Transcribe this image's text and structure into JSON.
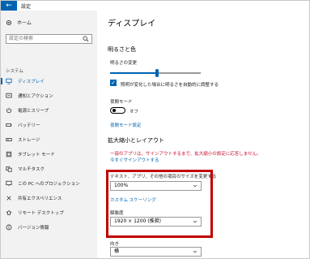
{
  "titlebar": {
    "back_glyph": "←",
    "title": "設定"
  },
  "sidebar": {
    "home_label": "ホーム",
    "search_placeholder": "設定の検索",
    "section_label": "システム",
    "items": [
      {
        "label": "ディスプレイ",
        "icon": "monitor-icon",
        "active": true
      },
      {
        "label": "通知とアクション",
        "icon": "notification-icon"
      },
      {
        "label": "電源とスリープ",
        "icon": "power-icon"
      },
      {
        "label": "バッテリー",
        "icon": "battery-icon"
      },
      {
        "label": "ストレージ",
        "icon": "storage-icon"
      },
      {
        "label": "タブレット モード",
        "icon": "tablet-icon"
      },
      {
        "label": "マルチタスク",
        "icon": "multitask-icon"
      },
      {
        "label": "この PC へのプロジェクション",
        "icon": "projection-icon"
      },
      {
        "label": "共有エクスペリエンス",
        "icon": "share-icon"
      },
      {
        "label": "リモート デスクトップ",
        "icon": "remote-icon"
      },
      {
        "label": "バージョン情報",
        "icon": "info-icon"
      }
    ]
  },
  "main": {
    "title": "ディスプレイ",
    "brightness_heading": "明るさと色",
    "brightness_label": "明るさの変更",
    "brightness_value": 0.52,
    "auto_brightness_label": "照明が変化した場合に明るさを自動的に調整する",
    "night_mode_label": "夜間モード",
    "night_mode_state": "オフ",
    "night_mode_settings_link": "夜間モード設定",
    "scale_heading": "拡大縮小とレイアウト",
    "warning_text": "一部のアプリは、サインアウトするまで、拡大縮小の設定に応答しません。",
    "signout_link": "今すぐサインアウトする",
    "scale_label": "テキスト、アプリ、その他の項目のサイズを変更する",
    "scale_value": "100%",
    "custom_scaling_link": "カスタム スケーリング",
    "resolution_label": "解像度",
    "resolution_value": "1920 × 1200 (推奨)",
    "orientation_label": "向き",
    "orientation_value": "横"
  },
  "colors": {
    "accent": "#0063b1",
    "highlight": "#c00000",
    "warning": "#c8102e"
  }
}
